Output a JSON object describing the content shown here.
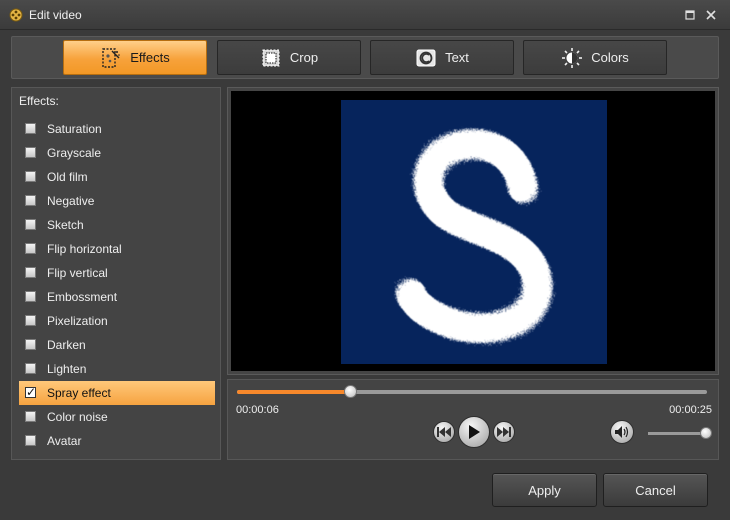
{
  "window": {
    "title": "Edit video"
  },
  "tabs": [
    {
      "label": "Effects",
      "icon": "effects-icon",
      "active": true
    },
    {
      "label": "Crop",
      "icon": "crop-icon",
      "active": false
    },
    {
      "label": "Text",
      "icon": "text-icon",
      "active": false
    },
    {
      "label": "Colors",
      "icon": "colors-icon",
      "active": false
    }
  ],
  "effects": {
    "heading": "Effects:",
    "items": [
      {
        "label": "Saturation",
        "checked": false
      },
      {
        "label": "Grayscale",
        "checked": false
      },
      {
        "label": "Old film",
        "checked": false
      },
      {
        "label": "Negative",
        "checked": false
      },
      {
        "label": "Sketch",
        "checked": false
      },
      {
        "label": "Flip horizontal",
        "checked": false
      },
      {
        "label": "Flip vertical",
        "checked": false
      },
      {
        "label": "Embossment",
        "checked": false
      },
      {
        "label": "Pixelization",
        "checked": false
      },
      {
        "label": "Darken",
        "checked": false
      },
      {
        "label": "Lighten",
        "checked": false
      },
      {
        "label": "Spray effect",
        "checked": true,
        "selected": true
      },
      {
        "label": "Color noise",
        "checked": false
      },
      {
        "label": "Avatar",
        "checked": false
      }
    ]
  },
  "preview": {
    "letter": "S"
  },
  "player": {
    "current_time": "00:00:06",
    "total_time": "00:00:25",
    "progress": 0.24,
    "volume": 0.97
  },
  "buttons": {
    "apply": "Apply",
    "cancel": "Cancel"
  },
  "colors": {
    "accent": "#f7882b",
    "video_bg": "#06245c"
  }
}
